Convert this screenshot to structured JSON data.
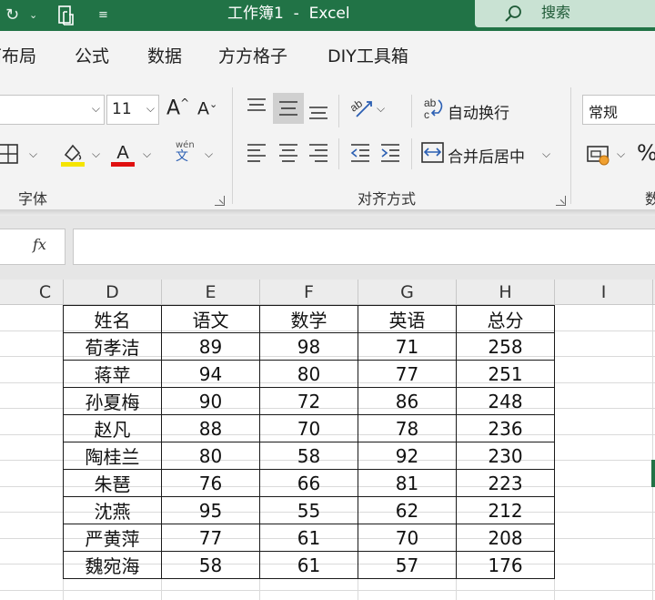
{
  "titlebar": {
    "title": "工作簿1  -  Excel",
    "search_label": "搜索",
    "icons": [
      "redo-icon",
      "dropdown-icon",
      "touch-mode-icon",
      "customize-qat-icon",
      "search-icon"
    ]
  },
  "ribbon_tabs": [
    "页面布局",
    "公式",
    "数据",
    "方方格子",
    "DIY工具箱"
  ],
  "font_group": {
    "label": "字体",
    "font_size": "11",
    "phonetic_label": "wén 文",
    "icons": [
      "increase-font-icon",
      "decrease-font-icon",
      "borders-icon",
      "fill-color-icon",
      "font-color-icon",
      "phonetic-guide-icon"
    ]
  },
  "alignment_group": {
    "label": "对齐方式",
    "wrap_text": "自动换行",
    "merge_center": "合并后居中",
    "icons": [
      "top-align-icon",
      "middle-align-icon",
      "bottom-align-icon",
      "orientation-icon",
      "align-left-icon",
      "center-icon",
      "align-right-icon",
      "decrease-indent-icon",
      "increase-indent-icon",
      "wrap-text-icon",
      "merge-center-icon"
    ]
  },
  "number_group": {
    "format": "常规",
    "label_partial": "数",
    "icons": [
      "accounting-format-icon",
      "percent-icon"
    ]
  },
  "formula_bar": {
    "fx": "fx",
    "value": ""
  },
  "columns": [
    "C",
    "D",
    "E",
    "F",
    "G",
    "H",
    "I"
  ],
  "table": {
    "headers": [
      "姓名",
      "语文",
      "数学",
      "英语",
      "总分"
    ],
    "rows": [
      [
        "荀孝洁",
        "89",
        "98",
        "71",
        "258"
      ],
      [
        "蒋苹",
        "94",
        "80",
        "77",
        "251"
      ],
      [
        "孙夏梅",
        "90",
        "72",
        "86",
        "248"
      ],
      [
        "赵凡",
        "88",
        "70",
        "78",
        "236"
      ],
      [
        "陶桂兰",
        "80",
        "58",
        "92",
        "230"
      ],
      [
        "朱琶",
        "76",
        "66",
        "81",
        "223"
      ],
      [
        "沈燕",
        "95",
        "55",
        "62",
        "212"
      ],
      [
        "严黄萍",
        "77",
        "61",
        "70",
        "208"
      ],
      [
        "魏宛海",
        "58",
        "61",
        "57",
        "176"
      ]
    ]
  },
  "colors": {
    "titlebar": "#217346",
    "search_box": "#c9e2d3",
    "ribbon": "#f3f3f3",
    "fill_color_bar": "#f5e400",
    "font_color_bar": "#e01010",
    "selection_edge": "#217346"
  }
}
